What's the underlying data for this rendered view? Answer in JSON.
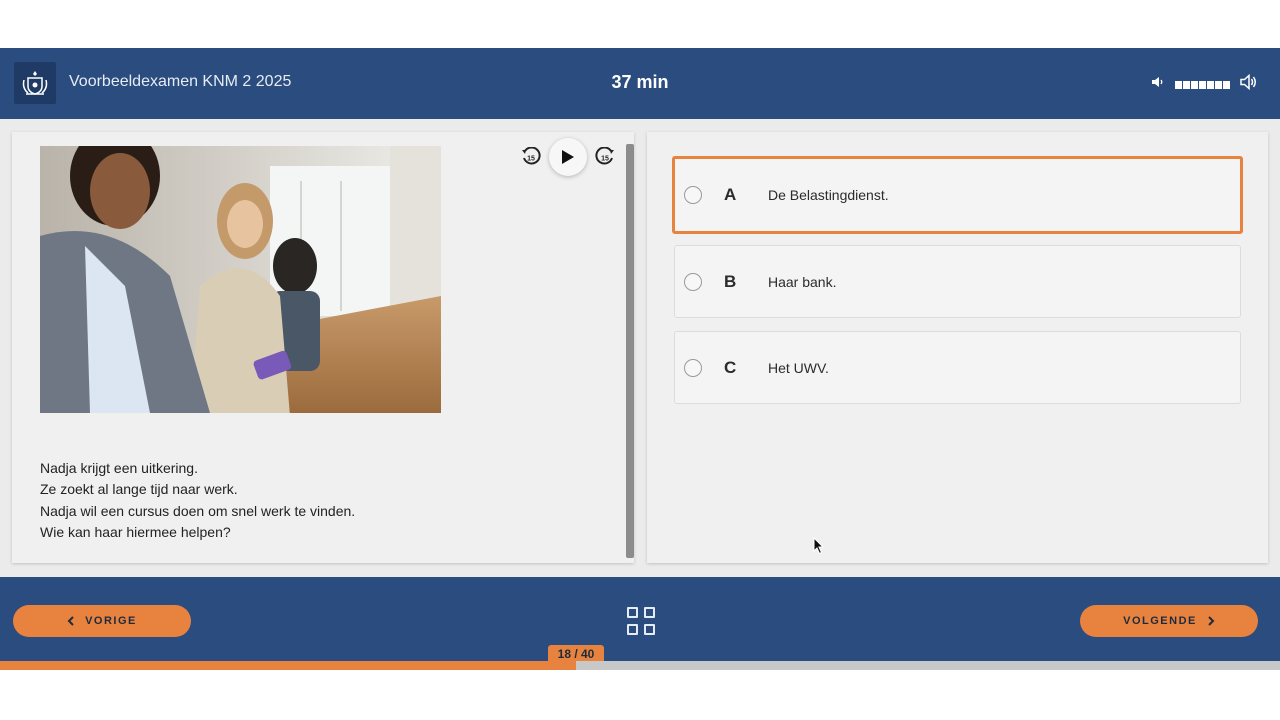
{
  "header": {
    "exam_title": "Voorbeeldexamen KNM 2 2025",
    "timer": "37 min",
    "volume_level": 7,
    "volume_max": 7
  },
  "media": {
    "photo_description_icon": "photo-waiting-room",
    "skip_back_label": "15",
    "skip_forward_label": "15"
  },
  "question": {
    "lines": [
      "Nadja krijgt een uitkering.",
      "Ze zoekt al lange tijd naar werk.",
      "Nadja wil een cursus doen om snel werk te vinden.",
      "Wie kan haar hiermee helpen?"
    ]
  },
  "options": [
    {
      "letter": "A",
      "text": "De Belastingdienst.",
      "selected": true
    },
    {
      "letter": "B",
      "text": "Haar bank.",
      "selected": false
    },
    {
      "letter": "C",
      "text": "Het UWV.",
      "selected": false
    }
  ],
  "footer": {
    "prev_label": "VORIGE",
    "next_label": "VOLGENDE",
    "progress_text": "18 / 40",
    "progress_current": 18,
    "progress_total": 40
  },
  "colors": {
    "primary": "#2b4c7e",
    "accent": "#e8823f"
  }
}
